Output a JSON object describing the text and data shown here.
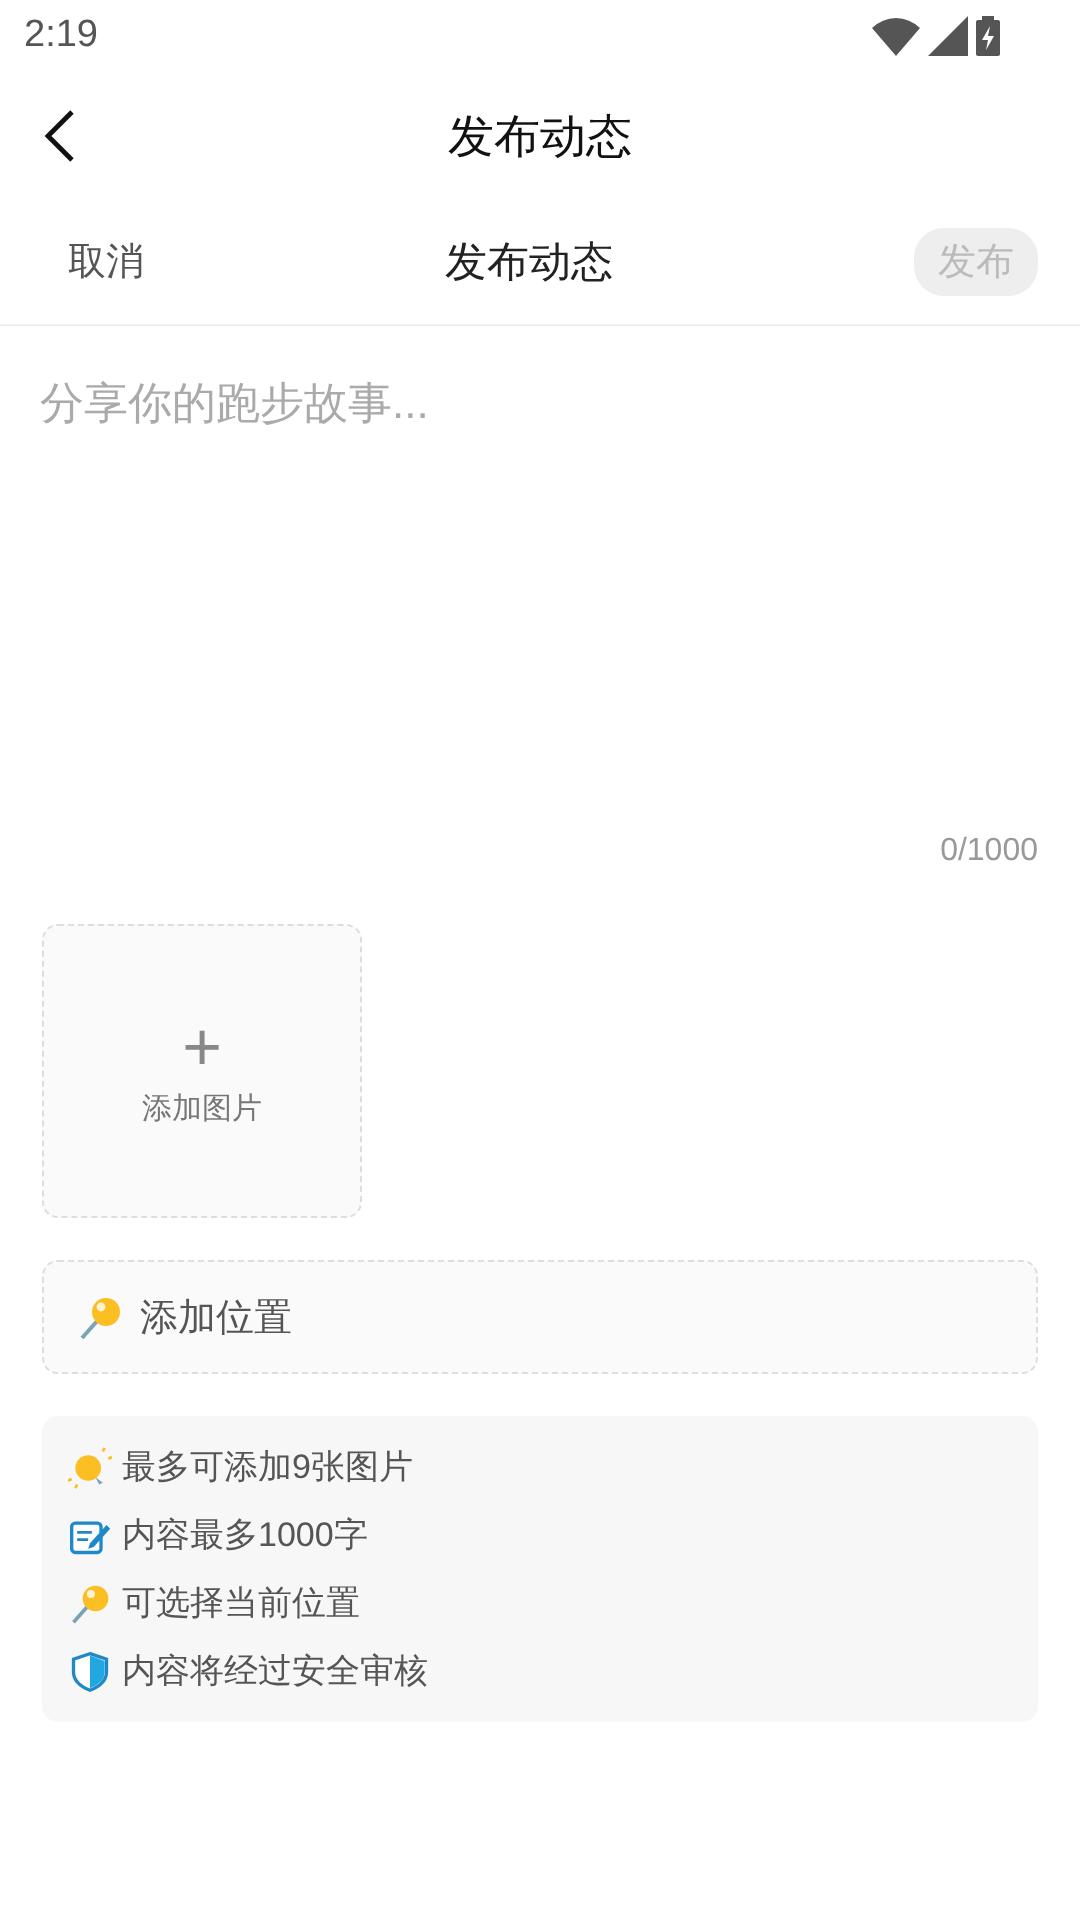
{
  "status_bar": {
    "time": "2:19"
  },
  "header": {
    "title": "发布动态"
  },
  "toolbar": {
    "cancel": "取消",
    "title": "发布动态",
    "publish": {
      "label": "发布",
      "disabled": true
    }
  },
  "editor": {
    "placeholder": "分享你的跑步故事...",
    "counter": "0/1000"
  },
  "add_image": {
    "plus": "+",
    "label": "添加图片"
  },
  "location": {
    "label": "添加位置"
  },
  "tips": [
    {
      "kind": "bulb",
      "text": "最多可添加9张图片"
    },
    {
      "kind": "memo",
      "text": "内容最多1000字"
    },
    {
      "kind": "pin",
      "text": "可选择当前位置"
    },
    {
      "kind": "shield",
      "text": "内容将经过安全审核"
    }
  ]
}
